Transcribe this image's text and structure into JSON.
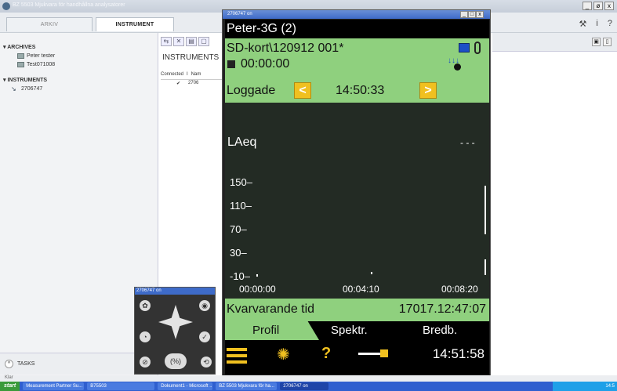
{
  "main_window": {
    "title": "BZ 5503 Mjukvara för handhållna analysatorer",
    "controls": [
      "_",
      "ø",
      "x"
    ]
  },
  "tabs": {
    "arkiv": "ARKIV",
    "instrument": "INSTRUMENT"
  },
  "top_right_icons": [
    "wrench-icon",
    "info-icon",
    "help-icon"
  ],
  "left_panel": {
    "archives_header": "ARCHIVES",
    "archives": [
      "Peter tester",
      "Test071008"
    ],
    "instruments_header": "INSTRUMENTS",
    "instruments": [
      "2706747"
    ],
    "tasks_label": "TASKS"
  },
  "mid_panel": {
    "header": "INSTRUMENTS",
    "columns": [
      "Connected",
      "I",
      "Nam"
    ],
    "row": {
      "checked": "✔",
      "name": "2706"
    }
  },
  "status_text": "Klar",
  "taskbar": {
    "start": "start",
    "tasks": [
      "Measurement Partner Su...",
      "B75503",
      "Dokument1 - Microsoft ...",
      "BZ 5503 Mjukvara för ha...",
      "2706747 on"
    ],
    "tray_time": "14:5"
  },
  "device": {
    "window_title": "2706747 on",
    "header": "Peter-3G (2)",
    "sd_path": "SD-kort\\120912 001*",
    "elapsed": "00:00:00",
    "log_label": "Loggade",
    "log_time": "14:50:33",
    "measure_label": "LAeq",
    "measure_value": "- - -",
    "remaining_label": "Kvarvarande tid",
    "remaining_value": "17017.12:47:07",
    "tabs": [
      "Profil",
      "Spektr.",
      "Bredb."
    ],
    "clock": "14:51:58",
    "colors": {
      "green": "#8fd07e",
      "chart_bg": "#232b24",
      "arrow": "#f0c020"
    }
  },
  "keypad": {
    "title": "2706747 on"
  },
  "chart_data": {
    "type": "line",
    "title": "LAeq",
    "y_ticks": [
      "150",
      "110",
      "70",
      "30",
      "-10"
    ],
    "x_ticks": [
      "00:00:00",
      "00:04:10",
      "00:08:20"
    ],
    "ylim": [
      -10,
      150
    ],
    "series": [
      {
        "values": []
      }
    ]
  }
}
